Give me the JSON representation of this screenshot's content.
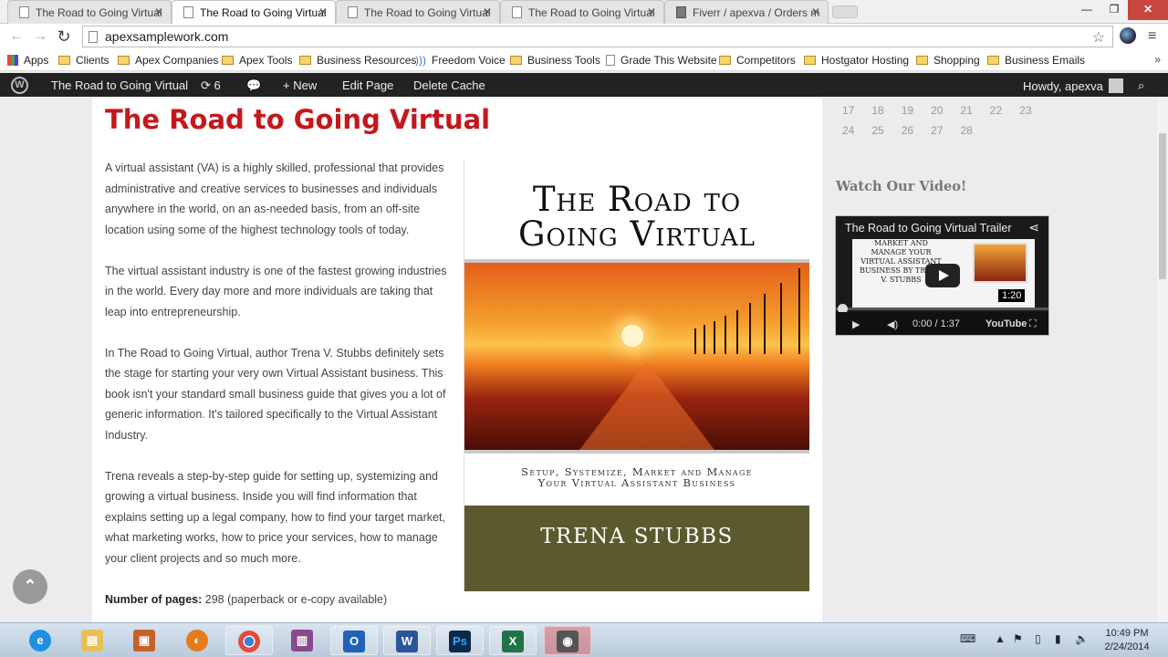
{
  "browser": {
    "tabs": [
      {
        "label": "The Road to Going Virtual",
        "active": false
      },
      {
        "label": "The Road to Going Virtual",
        "active": true
      },
      {
        "label": "The Road to Going Virtual",
        "active": false
      },
      {
        "label": "The Road to Going Virtual",
        "active": false
      },
      {
        "label": "Fiverr / apexva / Orders m",
        "active": false
      }
    ],
    "window_controls": {
      "minimize": "—",
      "restore": "❐",
      "close": "✕"
    },
    "nav": {
      "back": "←",
      "forward": "→",
      "reload": "↻"
    },
    "url": "apexsamplework.com",
    "star": "☆",
    "menu": "≡"
  },
  "bookmarks": {
    "items": [
      {
        "label": "Apps",
        "icon": "apps-icon"
      },
      {
        "label": "Clients",
        "icon": "folder-icon"
      },
      {
        "label": "Apex Companies",
        "icon": "folder-icon"
      },
      {
        "label": "Apex Tools",
        "icon": "folder-icon"
      },
      {
        "label": "Business Resources",
        "icon": "folder-icon"
      },
      {
        "label": "Freedom Voice",
        "icon": "wave-icon"
      },
      {
        "label": "Business Tools",
        "icon": "folder-icon"
      },
      {
        "label": "Grade This Website",
        "icon": "page-icon"
      },
      {
        "label": "Competitors",
        "icon": "folder-icon"
      },
      {
        "label": "Hostgator Hosting",
        "icon": "folder-icon"
      },
      {
        "label": "Shopping",
        "icon": "folder-icon"
      },
      {
        "label": "Business Emails",
        "icon": "folder-icon"
      }
    ],
    "more": "»"
  },
  "adminbar": {
    "site_name": "The Road to Going Virtual",
    "updates_count": "6",
    "new_label": "New",
    "edit_label": "Edit Page",
    "cache_label": "Delete Cache",
    "howdy": "Howdy, apexva"
  },
  "article": {
    "title": "The Road to Going Virtual",
    "paragraphs": [
      "A virtual assistant (VA) is a highly skilled, professional that provides administrative and creative services to businesses and individuals anywhere in the world, on an as-needed basis, from an off-site location using some of the highest technology tools of today.",
      "The virtual assistant industry is one of the fastest growing industries in the world. Every day more and more individuals are taking that leap into entrepreneurship.",
      "In The Road to Going Virtual, author Trena V. Stubbs definitely sets the stage for starting your very own Virtual Assistant business. This book isn't your standard small business guide that gives you a lot of generic information. It's tailored specifically to the Virtual Assistant Industry.",
      "Trena reveals a step-by-step guide for setting up, systemizing and growing a virtual business. Inside you will find information that explains setting up a legal company, how to find your target market, what marketing works, how to price your services, how to manage your client projects and so much more."
    ],
    "pages_label": "Number of pages:",
    "pages_value": " 298 (paperback or e-copy available)"
  },
  "book": {
    "title_line1": "The Road to",
    "title_line2": "Going Virtual",
    "subtitle_line1": "Setup, Systemize, Market and Manage",
    "subtitle_line2": "Your Virtual Assistant Business",
    "author": "TRENA STUBBS"
  },
  "sidebar": {
    "calendar_rows": [
      [
        "17",
        "18",
        "19",
        "20",
        "21",
        "22",
        "23"
      ],
      [
        "24",
        "25",
        "26",
        "27",
        "28"
      ]
    ],
    "video_heading": "Watch Our Video!",
    "video": {
      "title": "The Road to Going Virtual Trailer",
      "thumb_text": "MARKET AND MANAGE YOUR VIRTUAL ASSISTANT BUSINESS BY TRENA V. STUBBS",
      "duration_badge": "1:20",
      "time": "0:00 / 1:37",
      "brand": "YouTube"
    }
  },
  "taskbar": {
    "apps": [
      "internet-explorer",
      "file-explorer",
      "app-installer",
      "firefox",
      "chrome",
      "winrar",
      "outlook",
      "word",
      "photoshop",
      "excel",
      "screen-recorder"
    ],
    "clock_time": "10:49 PM",
    "clock_date": "2/24/2014"
  }
}
